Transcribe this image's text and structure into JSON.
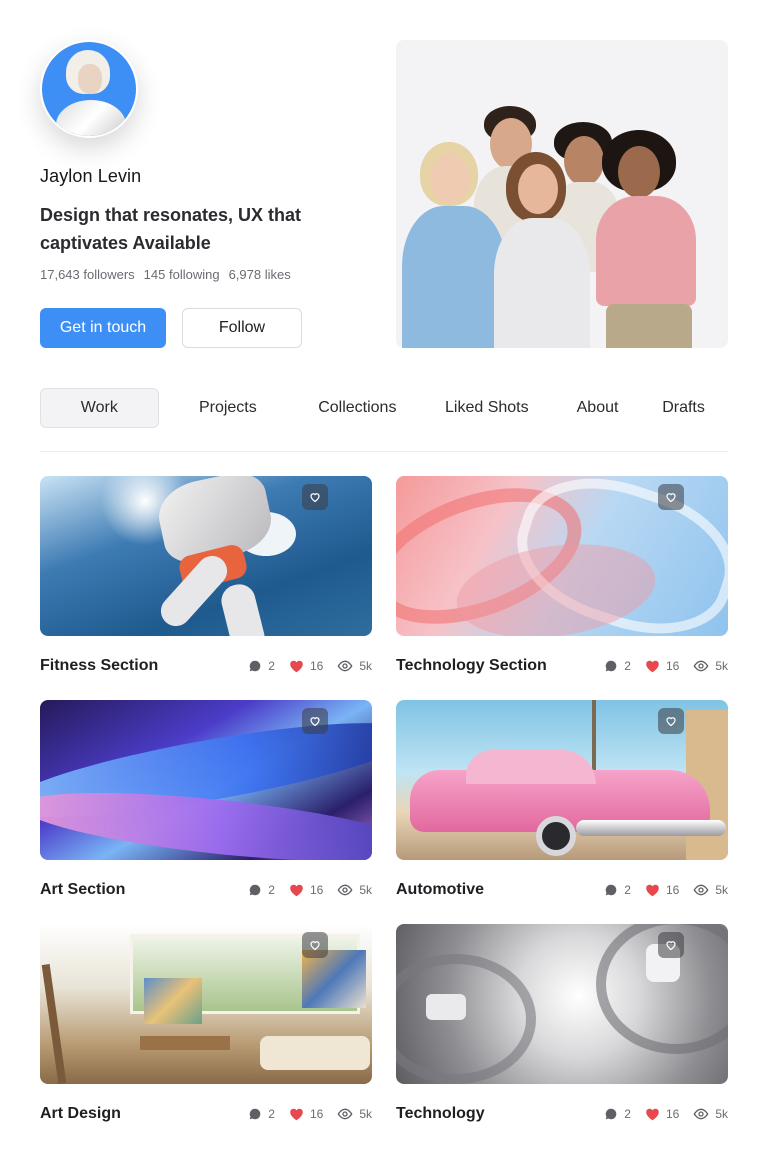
{
  "profile": {
    "name": "Jaylon Levin",
    "tagline": "Design that resonates, UX that captivates Available",
    "stats": {
      "followers": "17,643 followers",
      "following": "145 following",
      "likes": "6,978 likes"
    },
    "primary_button": "Get in touch",
    "secondary_button": "Follow"
  },
  "tabs": [
    {
      "label": "Work",
      "active": true
    },
    {
      "label": "Projects",
      "active": false
    },
    {
      "label": "Collections",
      "active": false
    },
    {
      "label": "Liked Shots",
      "active": false
    },
    {
      "label": "About",
      "active": false
    },
    {
      "label": "Drafts",
      "active": false
    }
  ],
  "shots": [
    {
      "title": "Fitness Section",
      "comments": "2",
      "likes": "16",
      "views": "5k"
    },
    {
      "title": "Technology Section",
      "comments": "2",
      "likes": "16",
      "views": "5k"
    },
    {
      "title": "Art Section",
      "comments": "2",
      "likes": "16",
      "views": "5k"
    },
    {
      "title": "Automotive",
      "comments": "2",
      "likes": "16",
      "views": "5k"
    },
    {
      "title": "Art Design",
      "comments": "2",
      "likes": "16",
      "views": "5k"
    },
    {
      "title": "Technology",
      "comments": "2",
      "likes": "16",
      "views": "5k"
    }
  ],
  "colors": {
    "accent": "#3d8ff5",
    "heart": "#e5484d",
    "muted_text": "#6b6b73"
  },
  "icons": {
    "comment": "comment-icon",
    "like": "heart-icon",
    "views": "eye-icon",
    "favorite": "heart-outline-icon"
  }
}
